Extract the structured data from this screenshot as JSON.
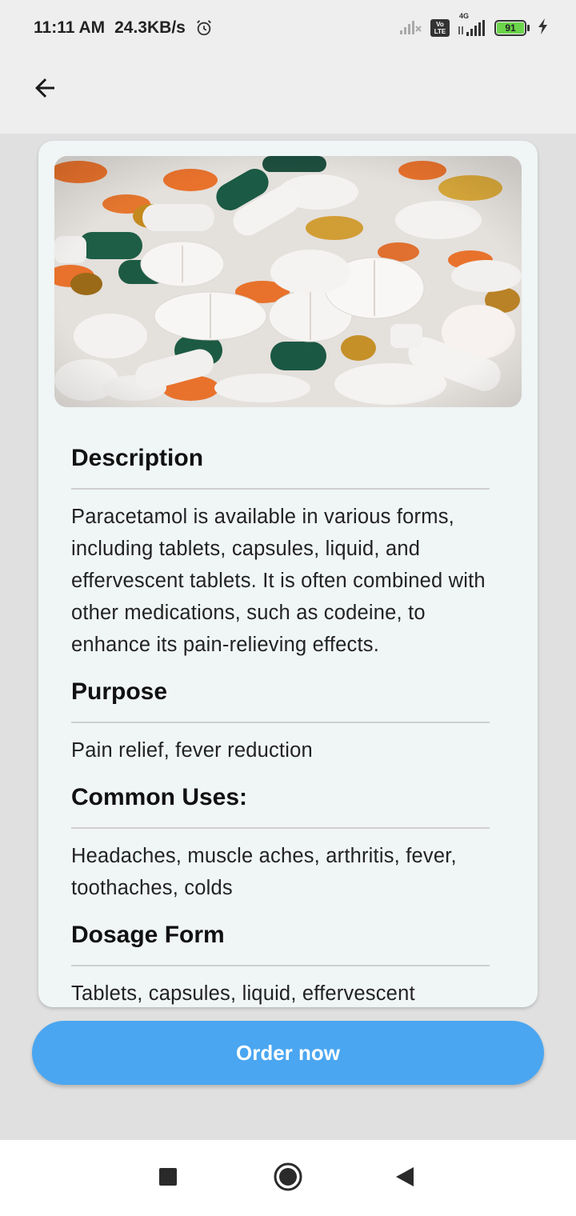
{
  "status_bar": {
    "time": "11:11 AM",
    "speed": "24.3KB/s",
    "battery": "91",
    "network": "4G",
    "volte": "Vo LTE",
    "icons": [
      "alarm-icon",
      "signal-no-sim-icon",
      "volte-icon",
      "signal-4g-icon",
      "battery-icon",
      "charging-icon"
    ]
  },
  "app_bar": {
    "back_icon": "arrow-back-icon"
  },
  "hero_image": {
    "subject": "pills-photo"
  },
  "sections": [
    {
      "title": "Description",
      "body": "Paracetamol is available in various forms, including tablets, capsules, liquid, and effervescent tablets. It is often combined with other medications, such as codeine, to enhance its pain-relieving effects."
    },
    {
      "title": "Purpose",
      "body": "Pain relief, fever reduction"
    },
    {
      "title": "Common Uses:",
      "body": "Headaches, muscle aches, arthritis, fever, toothaches, colds"
    },
    {
      "title": "Dosage Form",
      "body": "Tablets, capsules, liquid, effervescent"
    }
  ],
  "order_button": {
    "label": "Order now"
  },
  "nav_bar": {
    "icons": [
      "recent-apps-icon",
      "home-icon",
      "back-icon"
    ]
  },
  "colors": {
    "accent": "#4aa6f0",
    "card": "#f0f5f6",
    "background": "#e0e0e0"
  }
}
